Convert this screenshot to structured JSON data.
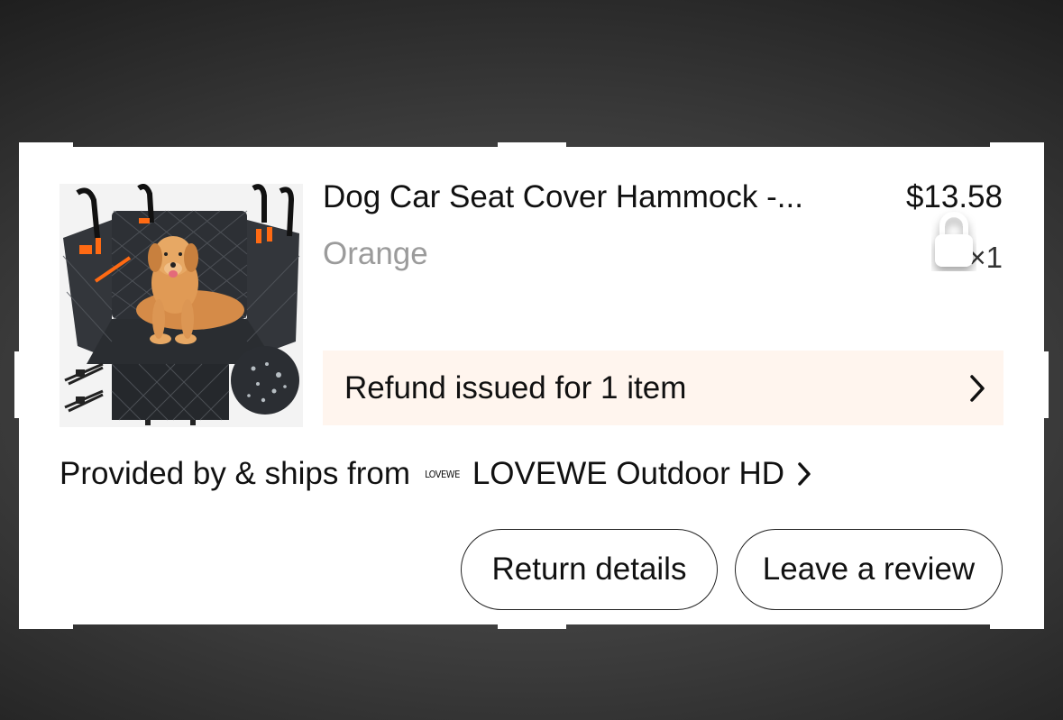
{
  "order_item": {
    "title": "Dog Car Seat Cover Hammock -...",
    "price": "$13.58",
    "variant": "Orange",
    "quantity": "×1",
    "refund_banner": "Refund issued for 1 item",
    "seller_prefix": "Provided by & ships from",
    "seller_logo_text": "LOVEWE",
    "seller_name": "LOVEWE Outdoor HD",
    "buttons": {
      "return_details": "Return details",
      "leave_review": "Leave a review"
    },
    "product_image_icon": "dog-car-seat-cover-image",
    "overlay_icon": "lock-icon"
  },
  "colors": {
    "refund_banner_bg": "#fff5ee",
    "variant_text": "#9b9b9b",
    "accent_orange": "#ff6a13"
  }
}
